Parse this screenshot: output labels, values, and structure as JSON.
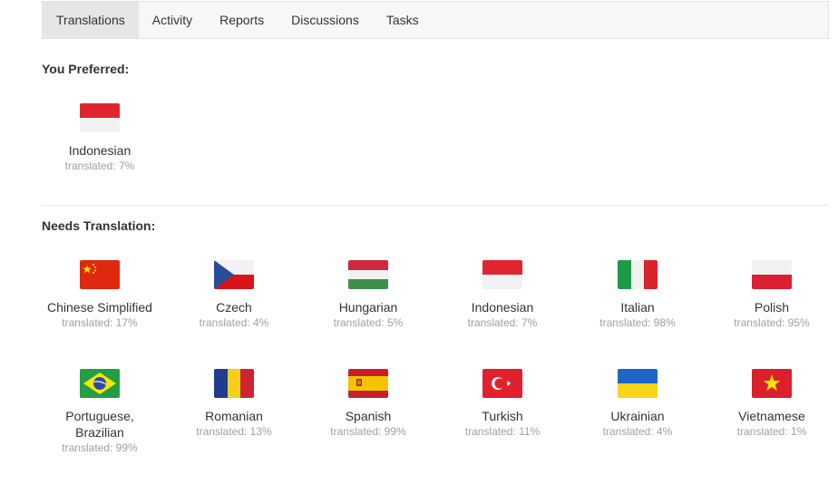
{
  "tabs": [
    "Translations",
    "Activity",
    "Reports",
    "Discussions",
    "Tasks"
  ],
  "active_tab": "Translations",
  "preferred": {
    "title": "You Preferred:",
    "items": [
      {
        "name": "Indonesian",
        "pct": "translated: 7%",
        "flag": "indonesia-flag-icon"
      }
    ]
  },
  "needs": {
    "title": "Needs Translation:",
    "items": [
      {
        "name": "Chinese Simplified",
        "pct": "translated: 17%",
        "flag": "china-flag-icon"
      },
      {
        "name": "Czech",
        "pct": "translated: 4%",
        "flag": "czech-flag-icon"
      },
      {
        "name": "Hungarian",
        "pct": "translated: 5%",
        "flag": "hungary-flag-icon"
      },
      {
        "name": "Indonesian",
        "pct": "translated: 7%",
        "flag": "indonesia-flag-icon"
      },
      {
        "name": "Italian",
        "pct": "translated: 98%",
        "flag": "italy-flag-icon"
      },
      {
        "name": "Polish",
        "pct": "translated: 95%",
        "flag": "poland-flag-icon"
      },
      {
        "name": "Portuguese, Brazilian",
        "pct": "translated: 99%",
        "flag": "brazil-flag-icon"
      },
      {
        "name": "Romanian",
        "pct": "translated: 13%",
        "flag": "romania-flag-icon"
      },
      {
        "name": "Spanish",
        "pct": "translated: 99%",
        "flag": "spain-flag-icon"
      },
      {
        "name": "Turkish",
        "pct": "translated: 11%",
        "flag": "turkey-flag-icon"
      },
      {
        "name": "Ukrainian",
        "pct": "translated: 4%",
        "flag": "ukraine-flag-icon"
      },
      {
        "name": "Vietnamese",
        "pct": "translated: 1%",
        "flag": "vietnam-flag-icon"
      }
    ]
  }
}
